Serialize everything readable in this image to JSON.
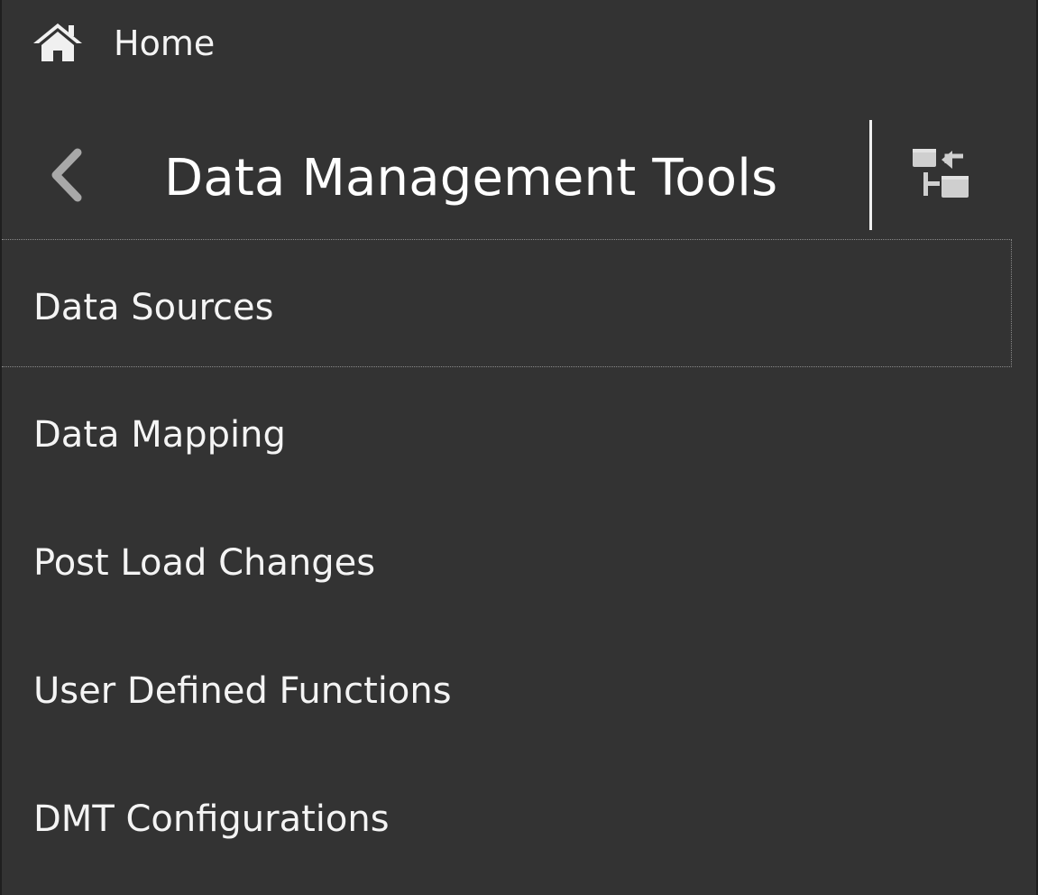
{
  "nav": {
    "home_label": "Home",
    "home_icon": "home-icon"
  },
  "header": {
    "title": "Data Management Tools",
    "back_icon": "chevron-left-icon",
    "switch_icon": "switch-view-icon"
  },
  "menu": {
    "items": [
      {
        "label": "Data Sources",
        "selected": true
      },
      {
        "label": "Data Mapping",
        "selected": false
      },
      {
        "label": "Post Load Changes",
        "selected": false
      },
      {
        "label": "User Defined Functions",
        "selected": false
      },
      {
        "label": "DMT Configurations",
        "selected": false
      }
    ]
  },
  "colors": {
    "background": "#333333",
    "text": "#f4f4f4",
    "selection_border": "#8a8a8a"
  }
}
